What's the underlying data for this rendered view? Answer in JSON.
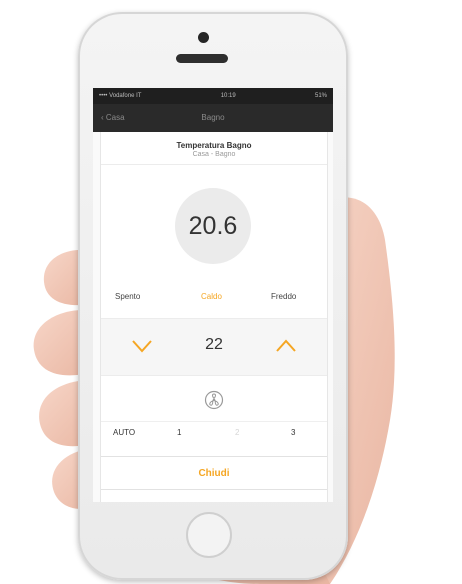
{
  "statusbar": {
    "carrier": "•••• Vodafone IT",
    "time": "10:19",
    "battery": "51%"
  },
  "navbar": {
    "back_label": "‹ Casa",
    "title": "Bagno"
  },
  "card": {
    "title": "Temperatura Bagno",
    "subtitle": "Casa - Bagno"
  },
  "current_temperature": "20.6",
  "modes": {
    "off": "Spento",
    "heat": "Caldo",
    "cool": "Freddo",
    "active": "heat"
  },
  "setpoint": {
    "value": "22"
  },
  "fan": {
    "icon": "fan-icon",
    "options": [
      "AUTO",
      "1",
      "2",
      "3"
    ],
    "selected": "2"
  },
  "close_label": "Chiudi",
  "colors": {
    "accent": "#f5a623",
    "skin": "#f2c7b5"
  }
}
